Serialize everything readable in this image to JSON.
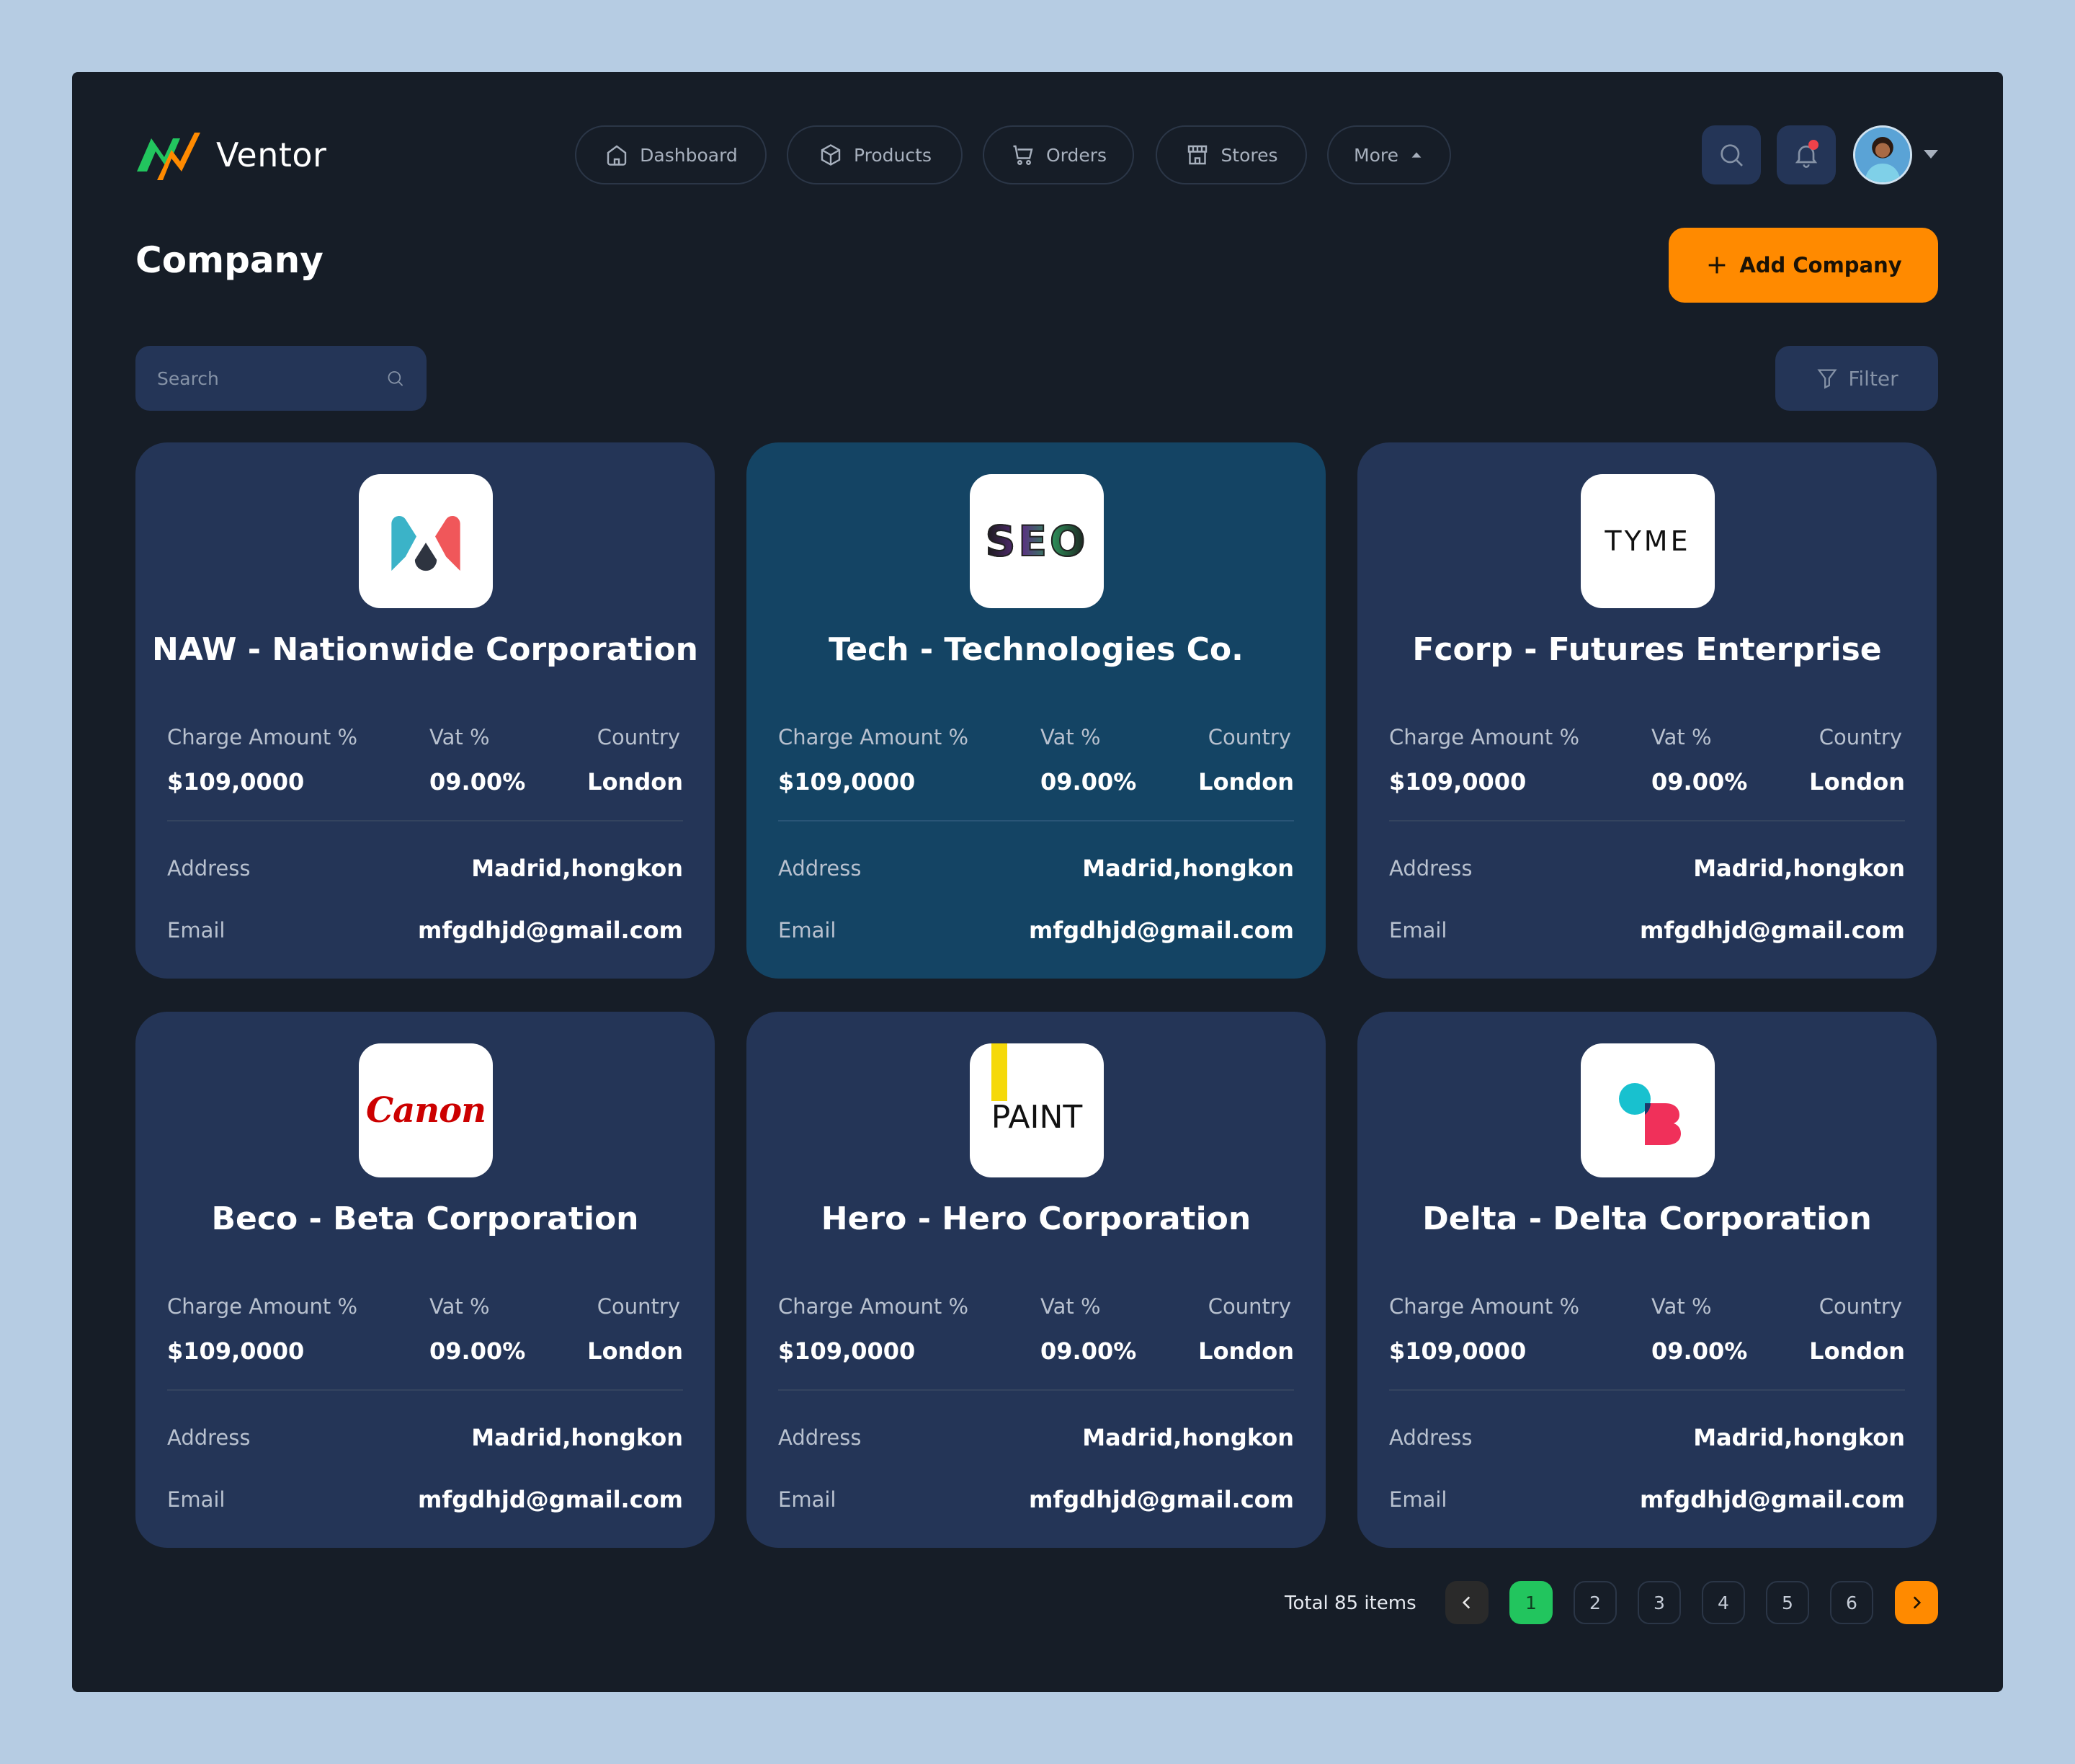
{
  "app": {
    "brand": "Ventor"
  },
  "nav": [
    {
      "label": "Dashboard",
      "icon": "home-icon"
    },
    {
      "label": "Products",
      "icon": "box-icon"
    },
    {
      "label": "Orders",
      "icon": "cart-icon"
    },
    {
      "label": "Stores",
      "icon": "store-icon"
    },
    {
      "label": "More",
      "icon": "caret-up-icon"
    }
  ],
  "page": {
    "title": "Company",
    "add_label": "Add Company"
  },
  "search": {
    "placeholder": "Search"
  },
  "filter": {
    "label": "Filter"
  },
  "labels": {
    "charge": "Charge Amount %",
    "vat": "Vat %",
    "country": "Country",
    "address": "Address",
    "email": "Email"
  },
  "companies": [
    {
      "name": "NAW - Nationwide Corporation",
      "logo": "m-logo",
      "charge": "$109,0000",
      "vat": "09.00%",
      "country": "London",
      "address": "Madrid,hongkon",
      "email": "mfgdhjd@gmail.com"
    },
    {
      "name": "Tech - Technologies Co.",
      "logo": "seo-logo",
      "logo_text": "SEO",
      "charge": "$109,0000",
      "vat": "09.00%",
      "country": "London",
      "address": "Madrid,hongkon",
      "email": "mfgdhjd@gmail.com"
    },
    {
      "name": "Fcorp - Futures Enterprise",
      "logo": "tyme-logo",
      "logo_text": "TYME",
      "charge": "$109,0000",
      "vat": "09.00%",
      "country": "London",
      "address": "Madrid,hongkon",
      "email": "mfgdhjd@gmail.com"
    },
    {
      "name": "Beco - Beta Corporation",
      "logo": "canon-logo",
      "logo_text": "Canon",
      "charge": "$109,0000",
      "vat": "09.00%",
      "country": "London",
      "address": "Madrid,hongkon",
      "email": "mfgdhjd@gmail.com"
    },
    {
      "name": "Hero - Hero Corporation",
      "logo": "paint-logo",
      "logo_text": "PAINT",
      "charge": "$109,0000",
      "vat": "09.00%",
      "country": "London",
      "address": "Madrid,hongkon",
      "email": "mfgdhjd@gmail.com"
    },
    {
      "name": "Delta - Delta Corporation",
      "logo": "delta-logo",
      "charge": "$109,0000",
      "vat": "09.00%",
      "country": "London",
      "address": "Madrid,hongkon",
      "email": "mfgdhjd@gmail.com"
    }
  ],
  "pagination": {
    "total_label": "Total 85 items",
    "pages": [
      "1",
      "2",
      "3",
      "4",
      "5",
      "6"
    ],
    "current": "1"
  },
  "colors": {
    "accent": "#ff8a00",
    "active_page": "#22c55e",
    "card": "#243557",
    "card_active": "#144464",
    "background": "#161d27"
  }
}
